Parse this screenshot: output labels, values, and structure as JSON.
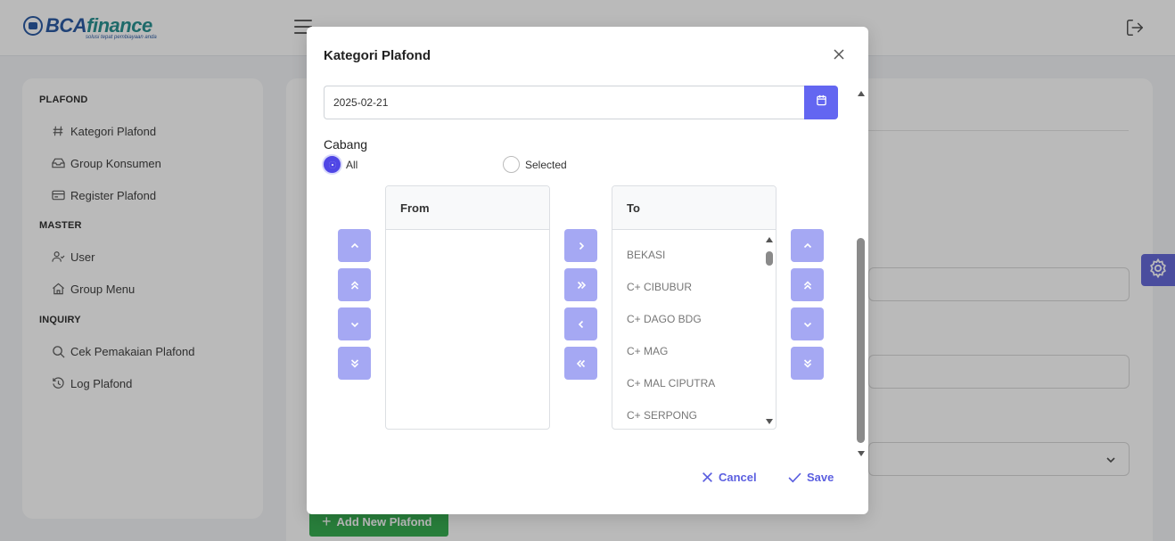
{
  "app": {
    "logo_text_a": "BCA",
    "logo_text_b": "finance",
    "logo_tagline": "solusi tepat pembiayaan anda"
  },
  "sidebar": {
    "sections": [
      {
        "title": "PLAFOND",
        "items": [
          {
            "label": "Kategori Plafond",
            "icon": "hash-icon"
          },
          {
            "label": "Group Konsumen",
            "icon": "inbox-icon"
          },
          {
            "label": "Register Plafond",
            "icon": "card-icon"
          }
        ]
      },
      {
        "title": "MASTER",
        "items": [
          {
            "label": "User",
            "icon": "user-icon"
          },
          {
            "label": "Group Menu",
            "icon": "home-icon"
          }
        ]
      },
      {
        "title": "INQUIRY",
        "items": [
          {
            "label": "Cek Pemakaian Plafond",
            "icon": "search-icon"
          },
          {
            "label": "Log Plafond",
            "icon": "history-icon"
          }
        ]
      }
    ]
  },
  "content": {
    "add_button_label": "Add New Plafond"
  },
  "modal": {
    "title": "Kategori Plafond",
    "date_value": "2025-02-21",
    "cabang_label": "Cabang",
    "radio_all": "All",
    "radio_selected": "Selected",
    "from_header": "From",
    "to_header": "To",
    "from_items": [],
    "to_items": [
      "BEKASI",
      "C+ CIBUBUR",
      "C+ DAGO BDG",
      "C+ MAG",
      "C+ MAL CIPUTRA",
      "C+ SERPONG"
    ],
    "cancel_label": "Cancel",
    "save_label": "Save"
  },
  "colors": {
    "primary": "#6366f1",
    "primary_light": "#a5a8f3",
    "success": "#28a745",
    "brand_blue": "#1c4f9c"
  }
}
